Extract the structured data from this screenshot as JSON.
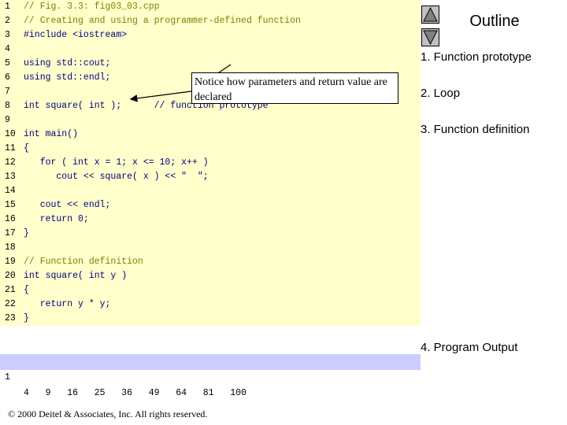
{
  "code": {
    "lines": [
      {
        "n": "1",
        "text": "// Fig. 3.3: fig03_03.cpp"
      },
      {
        "n": "2",
        "text": "// Creating and using a programmer-defined function"
      },
      {
        "n": "3",
        "text": "#include <iostream>"
      },
      {
        "n": "4",
        "text": ""
      },
      {
        "n": "5",
        "text": "using std::cout;"
      },
      {
        "n": "6",
        "text": "using std::endl;"
      },
      {
        "n": "7",
        "text": ""
      },
      {
        "n": "8",
        "text": "int square( int );      // function prototype"
      },
      {
        "n": "9",
        "text": ""
      },
      {
        "n": "10",
        "text": "int main()"
      },
      {
        "n": "11",
        "text": "{"
      },
      {
        "n": "12",
        "text": "   for ( int x = 1; x <= 10; x++ )"
      },
      {
        "n": "13",
        "text": "      cout << square( x ) << \"  \";"
      },
      {
        "n": "14",
        "text": ""
      },
      {
        "n": "15",
        "text": "   cout << endl;"
      },
      {
        "n": "16",
        "text": "   return 0;"
      },
      {
        "n": "17",
        "text": "}"
      },
      {
        "n": "18",
        "text": ""
      },
      {
        "n": "19",
        "text": "// Function definition"
      },
      {
        "n": "20",
        "text": "int square( int y )"
      },
      {
        "n": "21",
        "text": "{"
      },
      {
        "n": "22",
        "text": "   return y * y;"
      },
      {
        "n": "23",
        "text": "}"
      }
    ]
  },
  "callout": {
    "text": "Notice how parameters and return value are declared"
  },
  "outline": {
    "title": "Outline",
    "items": [
      "1.  Function prototype",
      "2.  Loop",
      "3.  Function definition",
      "4.  Program Output"
    ]
  },
  "output": {
    "line_number": "1",
    "text": "4   9   16   25   36   49   64   81   100"
  },
  "footer": {
    "copyright": "© 2000 Deitel & Associates, Inc.  All rights reserved."
  },
  "icons": {
    "nav_up": "triangle-up-icon",
    "nav_down": "triangle-down-icon"
  },
  "colors": {
    "code_background": "#ffffcc",
    "output_background": "#ccccff",
    "comment": "#808000",
    "keyword": "#000080"
  }
}
